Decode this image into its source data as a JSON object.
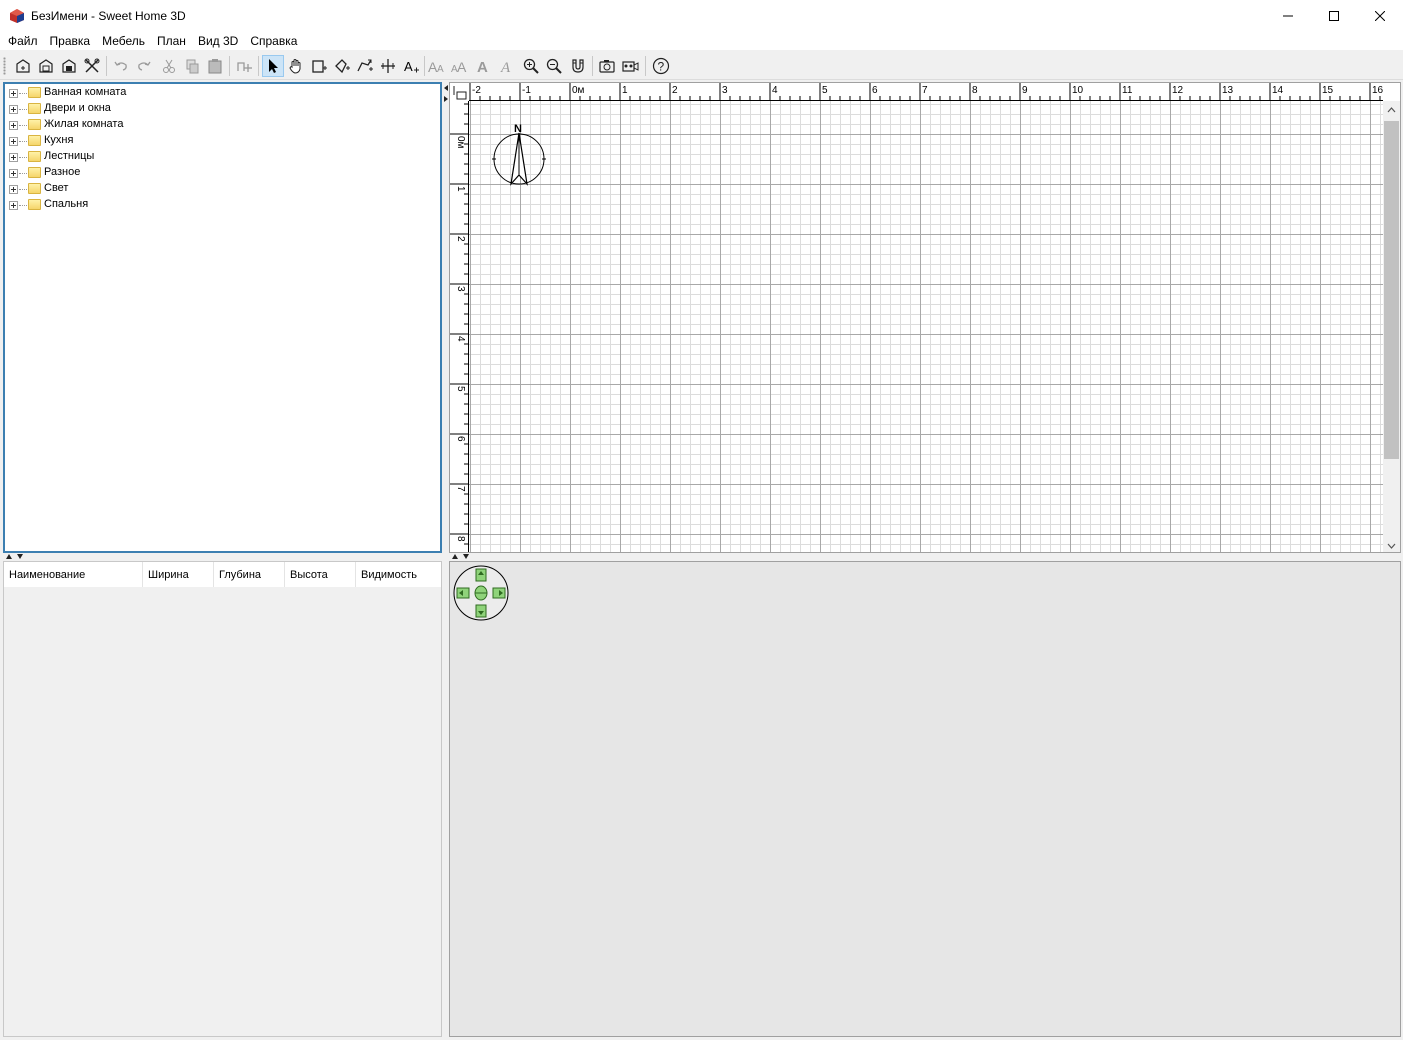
{
  "window": {
    "title": "БезИмени - Sweet Home 3D"
  },
  "menu": [
    "Файл",
    "Правка",
    "Мебель",
    "План",
    "Вид 3D",
    "Справка"
  ],
  "catalog": {
    "categories": [
      "Ванная комната",
      "Двери и окна",
      "Жилая комната",
      "Кухня",
      "Лестницы",
      "Разное",
      "Свет",
      "Спальня"
    ]
  },
  "furniture_table": {
    "columns": [
      "Наименование",
      "Ширина",
      "Глубина",
      "Высота",
      "Видимость"
    ]
  },
  "plan": {
    "ruler_top_labels": [
      "-2",
      "-1",
      "0м",
      "1",
      "2",
      "3",
      "4",
      "5",
      "6",
      "7",
      "8",
      "9",
      "10",
      "11",
      "12",
      "13",
      "14",
      "15",
      "16"
    ],
    "ruler_left_labels": [
      "0м",
      "1",
      "2",
      "3",
      "4",
      "5",
      "6",
      "7",
      "8"
    ],
    "compass_label": "N"
  },
  "toolbar": {
    "buttons": [
      {
        "name": "new-home-button",
        "icon": "new-home-icon"
      },
      {
        "name": "open-button",
        "icon": "open-icon"
      },
      {
        "name": "save-button",
        "icon": "save-icon"
      },
      {
        "name": "preferences-button",
        "icon": "tools-icon"
      },
      {
        "name": "undo-button",
        "icon": "undo-icon"
      },
      {
        "name": "redo-button",
        "icon": "redo-icon"
      },
      {
        "name": "cut-button",
        "icon": "cut-icon"
      },
      {
        "name": "copy-button",
        "icon": "copy-icon"
      },
      {
        "name": "paste-button",
        "icon": "paste-icon"
      },
      {
        "name": "add-furniture-button",
        "icon": "add-furniture-icon"
      },
      {
        "name": "select-mode-button",
        "icon": "arrow-cursor-icon",
        "selected": true
      },
      {
        "name": "pan-mode-button",
        "icon": "hand-icon"
      },
      {
        "name": "create-walls-button",
        "icon": "create-walls-icon"
      },
      {
        "name": "create-rooms-button",
        "icon": "create-rooms-icon"
      },
      {
        "name": "create-polylines-button",
        "icon": "create-polylines-icon"
      },
      {
        "name": "create-dimensions-button",
        "icon": "create-dimensions-icon"
      },
      {
        "name": "add-text-button",
        "icon": "add-text-icon"
      },
      {
        "name": "increase-text-button",
        "icon": "increase-text-icon"
      },
      {
        "name": "decrease-text-button",
        "icon": "decrease-text-icon"
      },
      {
        "name": "bold-text-button",
        "icon": "bold-icon"
      },
      {
        "name": "italic-text-button",
        "icon": "italic-icon"
      },
      {
        "name": "zoom-in-button",
        "icon": "zoom-in-icon"
      },
      {
        "name": "zoom-out-button",
        "icon": "zoom-out-icon"
      },
      {
        "name": "create-photo-button",
        "icon": "magnet-icon"
      },
      {
        "name": "photo-button",
        "icon": "camera-icon"
      },
      {
        "name": "video-button",
        "icon": "video-icon"
      },
      {
        "name": "help-button",
        "icon": "help-icon"
      }
    ]
  }
}
